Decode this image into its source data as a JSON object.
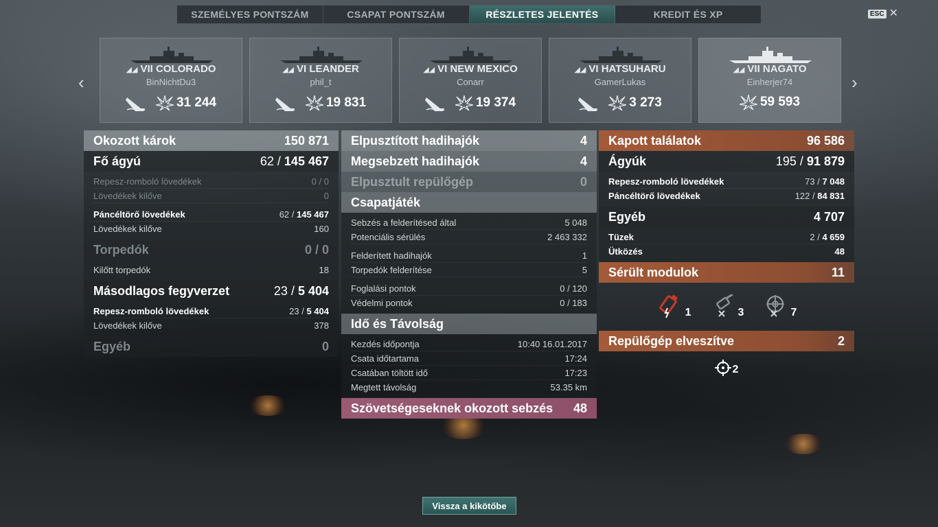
{
  "tabs": [
    "SZEMÉLYES PONTSZÁM",
    "CSAPAT PONTSZÁM",
    "RÉSZLETES JELENTÉS",
    "KREDIT ÉS XP"
  ],
  "esc_label": "ESC",
  "ships": [
    {
      "tier": "VII",
      "name": "COLORADO",
      "player": "BinNichtDu3",
      "score": "31 244"
    },
    {
      "tier": "VI",
      "name": "LEANDER",
      "player": "phil_t",
      "score": "19 831"
    },
    {
      "tier": "VI",
      "name": "NEW MEXICO",
      "player": "Conarr",
      "score": "19 374"
    },
    {
      "tier": "VI",
      "name": "HATSUHARU",
      "player": "GamerLukas",
      "score": "3 273"
    },
    {
      "tier": "VII",
      "name": "NAGATO",
      "player": "Einherjer74",
      "score": "59 593"
    }
  ],
  "damage": {
    "title": "Okozott károk",
    "total": "150 871",
    "main": {
      "title": "Fő ágyú",
      "hits": "62",
      "value": "145 467"
    },
    "he_title": "Repesz-romboló lövedékek",
    "he_value": "0 / 0",
    "he_fired_title": "Lövedékek kilőve",
    "he_fired": "0",
    "ap_title": "Páncéltörő lövedékek",
    "ap_hits": "62",
    "ap_value": "145 467",
    "ap_fired_title": "Lövedékek kilőve",
    "ap_fired": "160",
    "torp": {
      "title": "Torpedók",
      "value": "0 / 0"
    },
    "torp_fired_title": "Kilőtt torpedók",
    "torp_fired": "18",
    "secondary": {
      "title": "Másodlagos fegyverzet",
      "hits": "23",
      "value": "5 404"
    },
    "sec_he_title": "Repesz-romboló lövedékek",
    "sec_he_hits": "23",
    "sec_he_value": "5 404",
    "sec_fired_title": "Lövedékek kilőve",
    "sec_fired": "378",
    "other": {
      "title": "Egyéb",
      "value": "0"
    }
  },
  "middle": {
    "destroyed": {
      "title": "Elpusztított hadihajók",
      "value": "4"
    },
    "damaged": {
      "title": "Megsebzett hadihajók",
      "value": "4"
    },
    "planes": {
      "title": "Elpusztult repülőgép",
      "value": "0"
    },
    "teamplay": {
      "title": "Csapatjáték"
    },
    "rows1": [
      {
        "label": "Sebzés a felderítésed által",
        "value": "5 048"
      },
      {
        "label": "Potenciális sérülés",
        "value": "2 463 332"
      }
    ],
    "rows2": [
      {
        "label": "Felderített hadihajók",
        "value": "1"
      },
      {
        "label": "Torpedók felderítése",
        "value": "5"
      }
    ],
    "rows3": [
      {
        "label": "Foglalási pontok",
        "value": "0 / 120"
      },
      {
        "label": "Védelmi pontok",
        "value": "0 / 183"
      }
    ],
    "time": {
      "title": "Idő és Távolság"
    },
    "time_rows": [
      {
        "label": "Kezdés időpontja",
        "value": "10:40   16.01.2017"
      },
      {
        "label": "Csata időtartama",
        "value": "17:24"
      },
      {
        "label": "Csatában töltött idő",
        "value": "17:23"
      },
      {
        "label": "Megtett távolság",
        "value": "53.35 km"
      }
    ],
    "ally": {
      "title": "Szövetségeseknek okozott sebzés",
      "value": "48"
    }
  },
  "received": {
    "title": "Kapott találatok",
    "total": "96 586",
    "guns": {
      "title": "Ágyúk",
      "hits": "195",
      "value": "91 879"
    },
    "he_title": "Repesz-romboló lövedékek",
    "he_hits": "73",
    "he_value": "7 048",
    "ap_title": "Páncéltörő lövedékek",
    "ap_hits": "122",
    "ap_value": "84 831",
    "other": {
      "title": "Egyéb",
      "value": "4 707"
    },
    "fire_title": "Tüzek",
    "fire_hits": "2",
    "fire_value": "4 659",
    "ram_title": "Ütközés",
    "ram_value": "48",
    "modules": {
      "title": "Sérült modulok",
      "value": "11"
    },
    "module_counts": [
      "1",
      "3",
      "7"
    ],
    "planes_lost": {
      "title": "Repülőgép elveszítve",
      "value": "2"
    },
    "planes_count": "2"
  },
  "back_button": "Vissza a kikötőbe",
  "colors": {
    "accent_teal": "#3e6e6c",
    "received_orange": "#a45a38",
    "ally_pink": "#9a5a72"
  }
}
